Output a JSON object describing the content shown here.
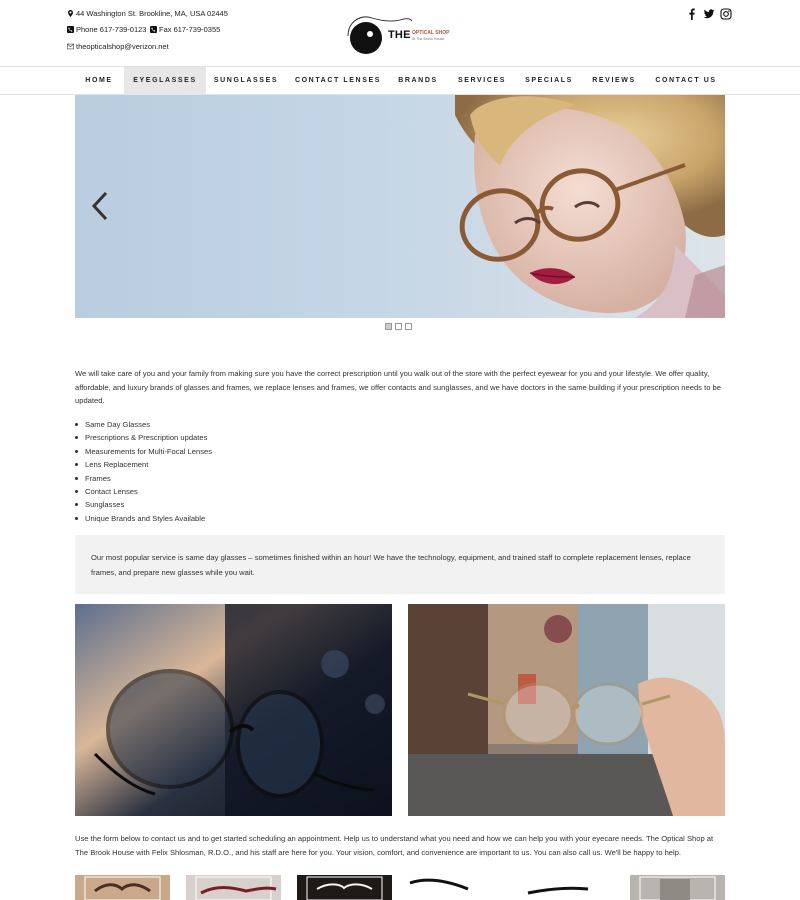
{
  "header": {
    "address": "44 Washington St. Brookline, MA, USA 02445",
    "phone": "Phone 617-739-0123",
    "fax": "Fax 617-739-0355",
    "email": "theopticalshop@verizon.net",
    "logo": {
      "the": "THE",
      "brand": "OPTICAL SHOP",
      "sub": "At The Brook House"
    },
    "social": [
      "facebook-icon",
      "twitter-icon",
      "instagram-icon"
    ]
  },
  "nav": {
    "items": [
      "HOME",
      "EYEGLASSES",
      "SUNGLASSES",
      "CONTACT LENSES",
      "BRANDS",
      "SERVICES",
      "SPECIALS",
      "REVIEWS",
      "CONTACT US"
    ],
    "active": "EYEGLASSES"
  },
  "slider": {
    "slides": 3,
    "active_slide": 1
  },
  "intro": "We will take care of you and your family from making sure you have the correct prescription until you walk out of the store with the perfect eyewear for you and your lifestyle. We offer quality, affordable, and luxury brands of glasses and frames, we replace lenses and frames, we offer contacts and sunglasses, and we have doctors in the same building if your prescription needs to be updated.",
  "services": [
    "Same Day Glasses",
    "Prescriptions & Prescription updates",
    "Measurements for Multi-Focal Lenses",
    "Lens Replacement",
    "Frames",
    "Contact Lenses",
    "Sunglasses",
    "Unique Brands and Styles Available"
  ],
  "callout": "Our most popular service is same day glasses – sometimes finished within an hour! We have the technology, equipment, and trained staff to complete replacement lenses, replace frames, and prepare new glasses while you wait.",
  "outro": "Use the form below to contact us and to get started scheduling an appointment. Help us to understand what you need and how we can help you with your eyecare needs. The Optical Shop at The Brook House with Felix Shlosman, R.D.O., and his staff are here for you. Your vision, comfort, and convenience are important to us. You can also call us. We'll be happy to help."
}
